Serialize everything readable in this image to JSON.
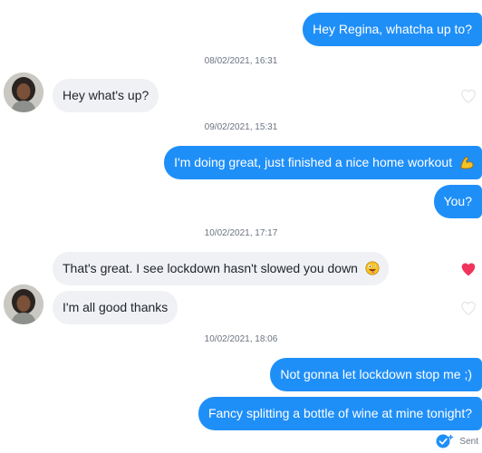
{
  "conversation": {
    "messages": [
      {
        "direction": "outgoing",
        "text": "Hey Regina, whatcha up to?"
      },
      {
        "direction": "incoming",
        "text": "Hey what's up?",
        "liked": false
      },
      {
        "direction": "outgoing",
        "text": "I'm doing great, just finished a nice home workout",
        "emoji": "flexed-biceps"
      },
      {
        "direction": "outgoing",
        "text": "You?"
      },
      {
        "direction": "incoming",
        "text": "That's great. I see lockdown hasn't slowed you down",
        "emoji": "zany-face",
        "liked": true
      },
      {
        "direction": "incoming",
        "text": "I'm all good thanks",
        "liked": false
      },
      {
        "direction": "outgoing",
        "text": "Not gonna let lockdown stop me ;)"
      },
      {
        "direction": "outgoing",
        "text": "Fancy splitting a bottle of wine at mine tonight?"
      }
    ],
    "timestamps": [
      "08/02/2021, 16:31",
      "09/02/2021, 15:31",
      "10/02/2021, 17:17",
      "10/02/2021, 18:06"
    ],
    "status": {
      "label": "Sent",
      "icon": "sent-check-icon"
    }
  },
  "colors": {
    "outgoing_bubble": "#1f8ff8",
    "incoming_bubble": "#f0f1f4",
    "liked_heart": "#f0345b",
    "unliked_heart": "#e4e6ea"
  }
}
